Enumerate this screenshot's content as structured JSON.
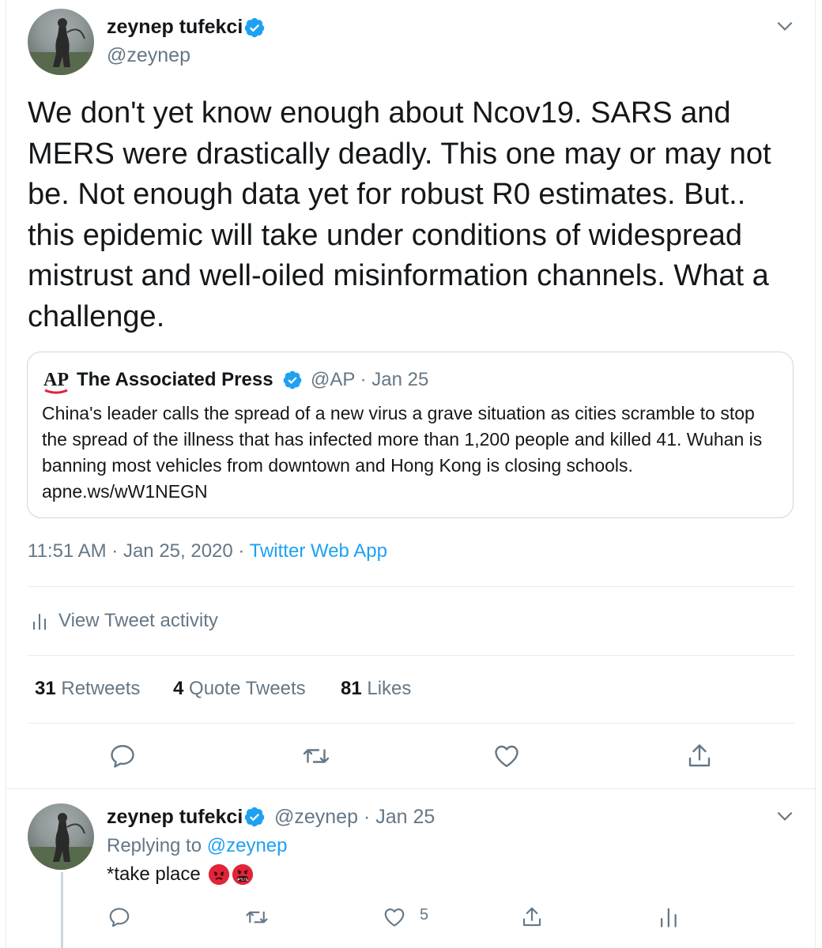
{
  "main_tweet": {
    "author_name": "zeynep tufekci",
    "author_handle": "@zeynep",
    "text": "We don't yet know enough about Ncov19. SARS and MERS were drastically deadly. This one may or may not be. Not enough data yet for robust R0 estimates. But.. this epidemic will take under conditions of widespread mistrust and well-oiled misinformation channels. What a challenge.",
    "quoted": {
      "logo_text": "AP",
      "author_name": "The Associated Press",
      "meta": "@AP · Jan 25",
      "text": "China's leader calls the spread of a new virus a grave situation as cities scramble to stop the spread of the illness that has infected more than 1,200 people and killed 41. Wuhan is banning most vehicles from downtown and Hong Kong is closing schools. apne.ws/wW1NEGN"
    },
    "time": "11:51 AM · Jan 25, 2020 · ",
    "source": "Twitter Web App",
    "activity_label": "View Tweet activity",
    "stats": {
      "retweets_count": "31",
      "retweets_label": "Retweets",
      "quotes_count": "4",
      "quotes_label": "Quote Tweets",
      "likes_count": "81",
      "likes_label": "Likes"
    }
  },
  "reply_tweet": {
    "author_name": "zeynep tufekci",
    "meta": "@zeynep · Jan 25",
    "replying_prefix": "Replying to ",
    "replying_to": "@zeynep",
    "text": "*take place",
    "emojis": [
      "pouting-face-emoji",
      "face-with-symbols-emoji"
    ],
    "like_count": "5"
  },
  "colors": {
    "text_primary": "#14171a",
    "text_secondary": "#657786",
    "accent": "#1da1f2",
    "divider": "#e6ecf0",
    "emoji_red": "#e0243a"
  },
  "icons": [
    "verified-badge-icon",
    "chevron-down-icon",
    "ap-logo",
    "analytics-icon",
    "reply-icon",
    "retweet-icon",
    "like-icon",
    "share-icon"
  ]
}
